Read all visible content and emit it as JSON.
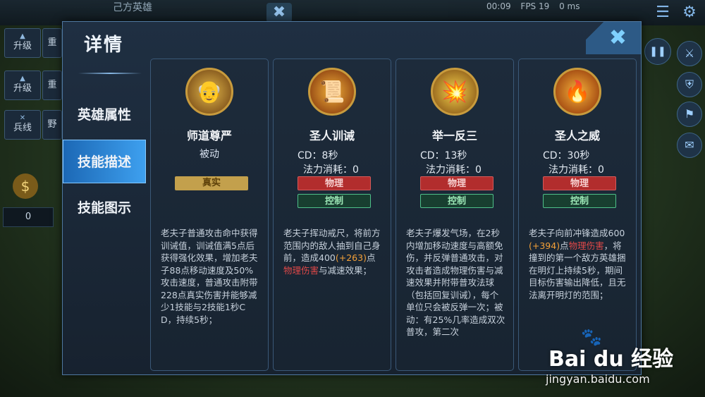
{
  "hud": {
    "team_label": "己方英雄",
    "timer": "00:09",
    "fps": "FPS 19",
    "ping": "0 ms",
    "gold": "0"
  },
  "left_buttons": [
    {
      "label": "升级",
      "side": "重"
    },
    {
      "label": "升级",
      "side": "重"
    },
    {
      "label": "兵线",
      "side": "野"
    }
  ],
  "panel": {
    "title": "详情",
    "close_icon": "close-icon",
    "tabs": [
      {
        "label": "英雄属性",
        "active": false
      },
      {
        "label": "技能描述",
        "active": true
      },
      {
        "label": "技能图示",
        "active": false
      }
    ]
  },
  "skills": [
    {
      "name": "师道尊严",
      "passive_label": "被动",
      "tags": [
        {
          "label": "真实",
          "type": "true"
        }
      ],
      "desc_parts": [
        {
          "text": "老夫子普通攻击命中获得训诫值，训诫值满5点后获得强化效果，增加老夫子88点移动速度及50%攻击速度，普通攻击附带228点真实伤害并能够减少1技能与2技能1秒CD，持续5秒；",
          "style": ""
        }
      ]
    },
    {
      "name": "圣人训诫",
      "cd": "CD：8秒",
      "cost": "法力消耗：0",
      "tags": [
        {
          "label": "物理",
          "type": "phys"
        },
        {
          "label": "控制",
          "type": "ctrl"
        }
      ],
      "desc_parts": [
        {
          "text": "老夫子挥动戒尺，将前方范围内的敌人抽到自己身前，造成400",
          "style": ""
        },
        {
          "text": "(+263)",
          "style": "orange"
        },
        {
          "text": "点",
          "style": ""
        },
        {
          "text": "物理伤害",
          "style": "red"
        },
        {
          "text": "与减速效果；",
          "style": ""
        }
      ]
    },
    {
      "name": "举一反三",
      "cd": "CD：13秒",
      "cost": "法力消耗：0",
      "tags": [
        {
          "label": "物理",
          "type": "phys"
        },
        {
          "label": "控制",
          "type": "ctrl"
        }
      ],
      "desc_parts": [
        {
          "text": "老夫子爆发气场，在2秒内增加移动速度与高额免伤，并反弹普通攻击，对攻击者造成物理伤害与减速效果并附带普攻法球（包括回复训诫），每个单位只会被反弹一次；被动：有25%几率造成双次普攻，第二次",
          "style": ""
        }
      ]
    },
    {
      "name": "圣人之威",
      "cd": "CD：30秒",
      "cost": "法力消耗：0",
      "tags": [
        {
          "label": "物理",
          "type": "phys"
        },
        {
          "label": "控制",
          "type": "ctrl"
        }
      ],
      "desc_parts": [
        {
          "text": "老夫子向前冲锋造成600",
          "style": ""
        },
        {
          "text": "(+394)",
          "style": "orange"
        },
        {
          "text": "点",
          "style": ""
        },
        {
          "text": "物理伤害",
          "style": "red"
        },
        {
          "text": "，将撞到的第一个敌方英雄捆在明灯上持续5秒，期间目标伤害输出降低，且无法离开明灯的范围；",
          "style": ""
        }
      ]
    }
  ],
  "watermark": {
    "logo": "Bai du 经验",
    "url": "jingyan.baidu.com"
  }
}
